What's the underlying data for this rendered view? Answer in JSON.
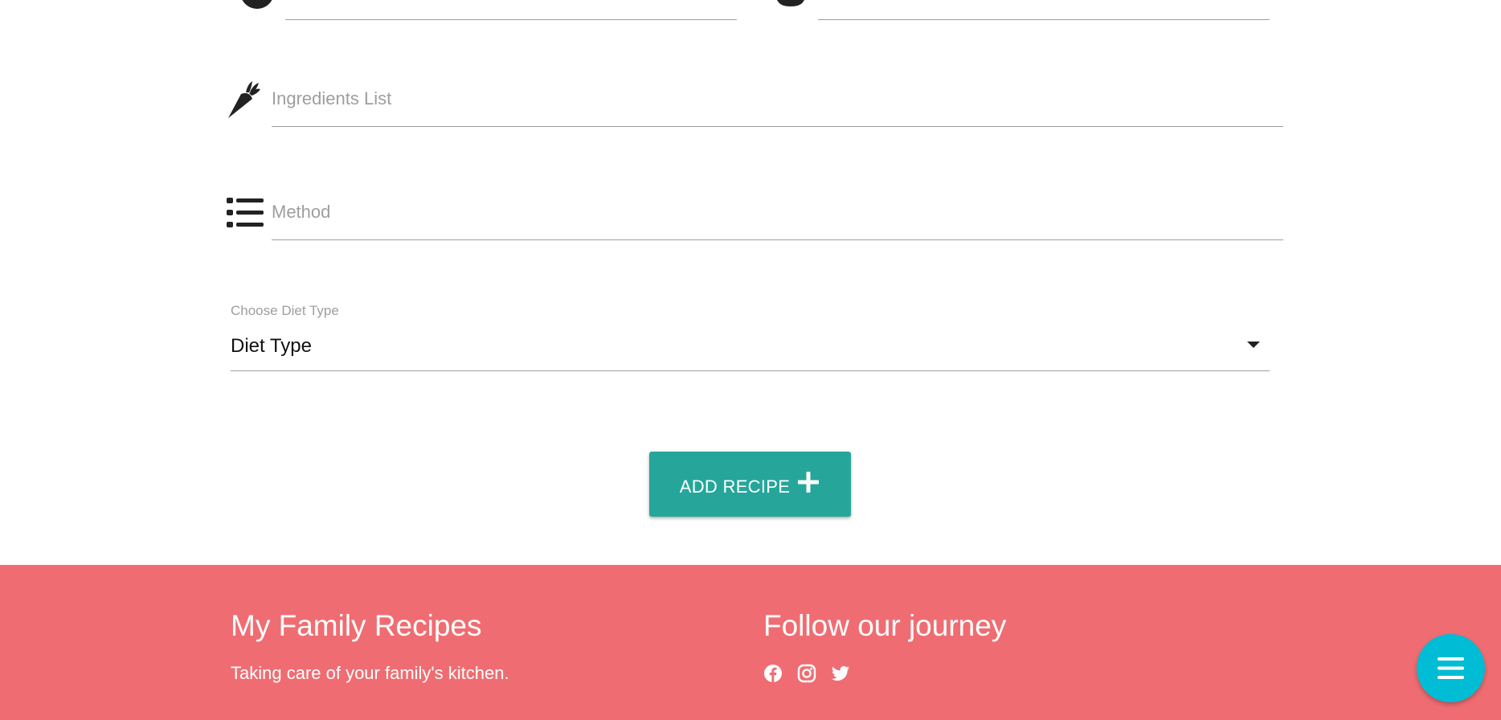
{
  "form": {
    "top_left_field": {
      "placeholder": ""
    },
    "top_right_field": {
      "placeholder": ""
    },
    "ingredients": {
      "placeholder": "Ingredients List",
      "icon": "carrot-icon"
    },
    "method": {
      "placeholder": "Method",
      "icon": "list-icon"
    },
    "diet_select": {
      "label": "Choose Diet Type",
      "selected": "Diet Type",
      "icon": "caret-down-icon"
    },
    "submit": {
      "label": "ADD RECIPE",
      "icon": "plus-icon"
    }
  },
  "footer": {
    "title": "My Family Recipes",
    "tagline": "Taking care of your family's kitchen.",
    "follow_title": "Follow our journey",
    "social": [
      "facebook-icon",
      "instagram-icon",
      "twitter-icon"
    ]
  },
  "fab": {
    "icon": "menu-icon"
  },
  "colors": {
    "button": "#26a69a",
    "footer_bg": "#ef6d72",
    "fab": "#00bcd4",
    "field_line": "#9e9e9e"
  }
}
